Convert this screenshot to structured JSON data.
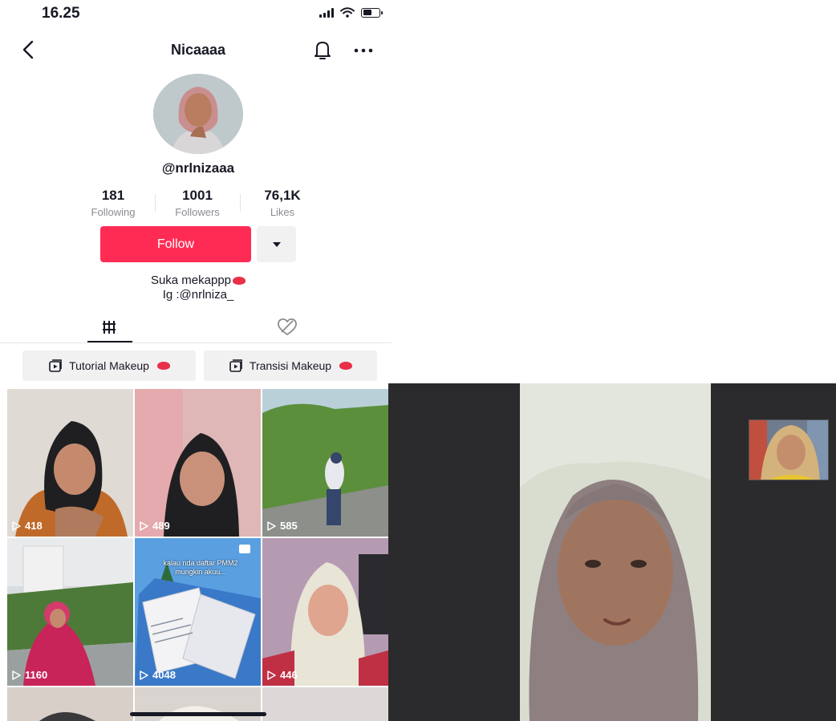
{
  "status_bar": {
    "time": "16.25"
  },
  "profile": {
    "name": "Nicaaaa",
    "username": "@nrlnizaaa",
    "stats": [
      {
        "value": "181",
        "label": "Following"
      },
      {
        "value": "1001",
        "label": "Followers"
      },
      {
        "value": "76,1K",
        "label": "Likes"
      }
    ],
    "follow_label": "Follow",
    "bio_line1": "Suka mekappp",
    "bio_line2": "Ig :@nrlniza_"
  },
  "playlists": [
    {
      "label": "Tutorial Makeup"
    },
    {
      "label": "Transisi Makeup"
    }
  ],
  "videos": [
    {
      "views": "418"
    },
    {
      "views": "489"
    },
    {
      "views": "585"
    },
    {
      "views": "1160"
    },
    {
      "views": "4048",
      "caption": "kalau nda daftar PMM2 mungkin akuu..."
    },
    {
      "views": "446"
    }
  ],
  "colors": {
    "accent": "#fe2c55",
    "text": "#161823",
    "muted": "#8a8b91",
    "chip_bg": "#f1f1f2"
  },
  "icons": [
    "back-arrow-icon",
    "bell-icon",
    "more-icon",
    "grid-icon",
    "liked-icon",
    "playlist-icon",
    "play-icon",
    "lips-emoji-icon",
    "image-post-icon"
  ]
}
